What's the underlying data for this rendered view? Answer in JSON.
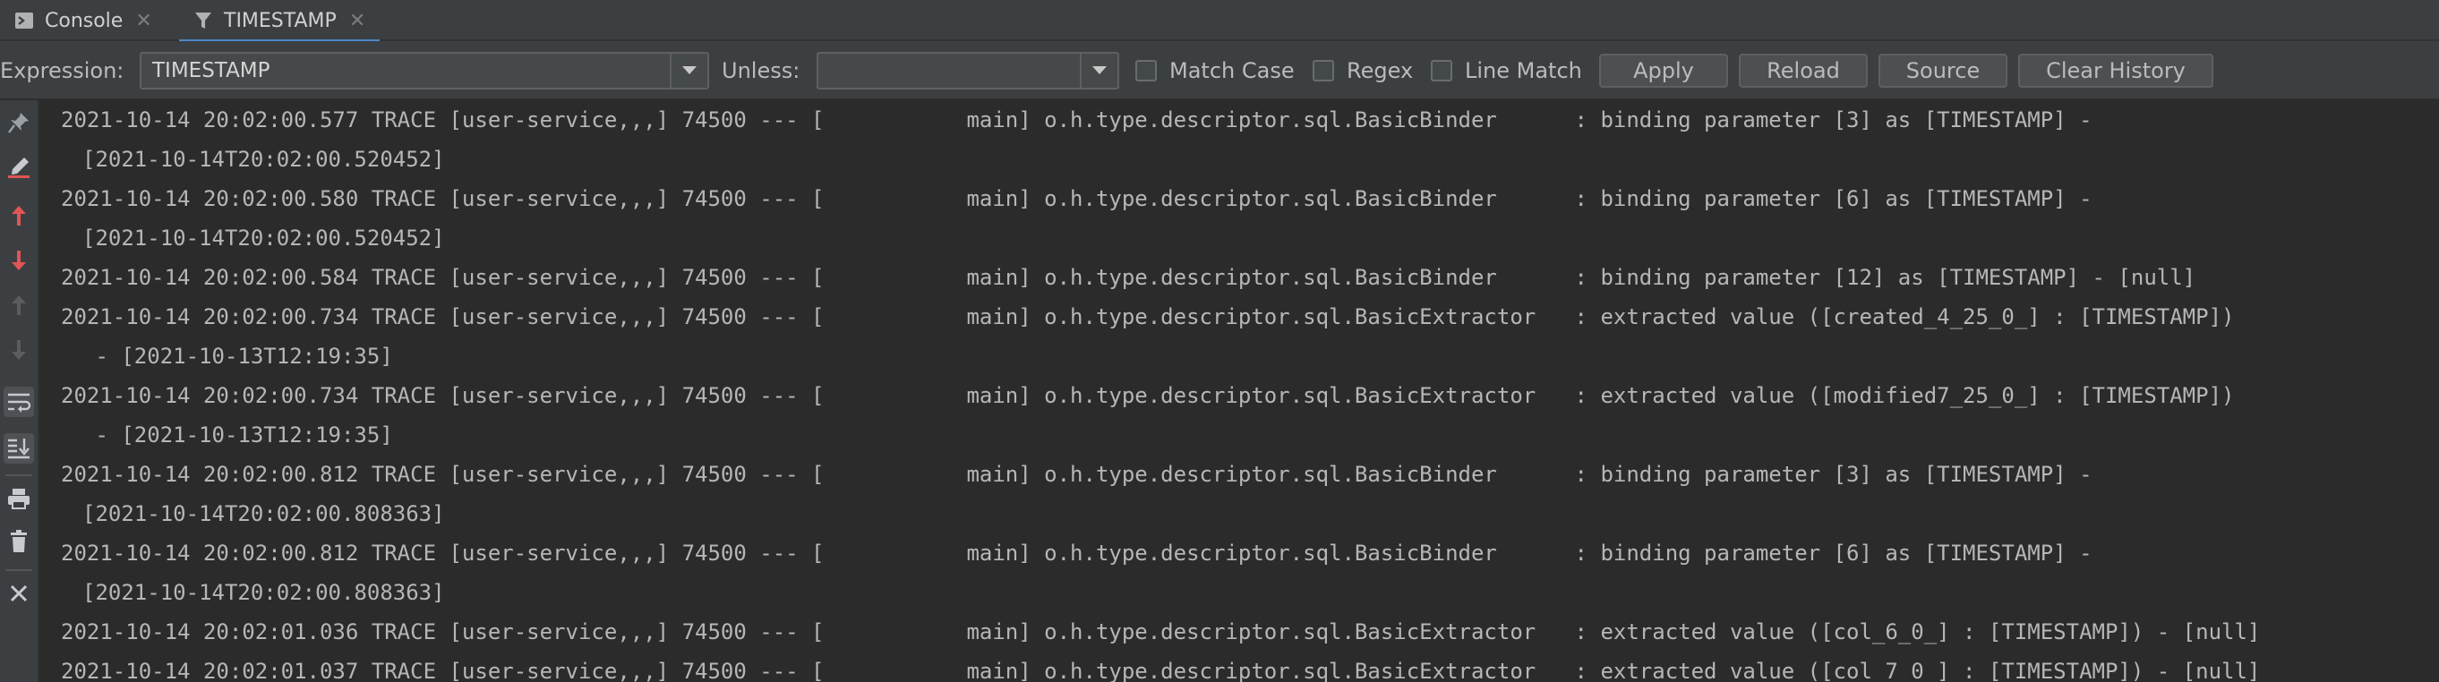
{
  "tabs": [
    {
      "label": "Console",
      "icon": "console-icon",
      "active": false
    },
    {
      "label": "TIMESTAMP",
      "icon": "filter-icon",
      "active": true
    }
  ],
  "filter": {
    "expression_label": "Expression:",
    "expression_value": "TIMESTAMP",
    "unless_label": "Unless:",
    "unless_value": "",
    "match_case_label": "Match Case",
    "regex_label": "Regex",
    "line_match_label": "Line Match",
    "apply_label": "Apply",
    "reload_label": "Reload",
    "source_label": "Source",
    "clear_history_label": "Clear History"
  },
  "gutter_icons": [
    "pin-icon",
    "clear-highlight-icon",
    "up-arrow-icon",
    "down-arrow-icon",
    "up-arrow-disabled-icon",
    "down-arrow-disabled-icon",
    "soft-wrap-icon",
    "scroll-to-end-icon",
    "print-icon",
    "trash-icon",
    "close-icon"
  ],
  "colors": {
    "accent": "#4a88c7",
    "up_arrow": "#e05555",
    "down_arrow": "#e05555"
  },
  "log_lines": [
    "2021-10-14 20:02:00.577 TRACE [user-service,,,] 74500 --- [           main] o.h.type.descriptor.sql.BasicBinder      : binding parameter [3] as [TIMESTAMP] -",
    "[2021-10-14T20:02:00.520452]",
    "2021-10-14 20:02:00.580 TRACE [user-service,,,] 74500 --- [           main] o.h.type.descriptor.sql.BasicBinder      : binding parameter [6] as [TIMESTAMP] -",
    "[2021-10-14T20:02:00.520452]",
    "2021-10-14 20:02:00.584 TRACE [user-service,,,] 74500 --- [           main] o.h.type.descriptor.sql.BasicBinder      : binding parameter [12] as [TIMESTAMP] - [null]",
    "2021-10-14 20:02:00.734 TRACE [user-service,,,] 74500 --- [           main] o.h.type.descriptor.sql.BasicExtractor   : extracted value ([created_4_25_0_] : [TIMESTAMP])",
    " - [2021-10-13T12:19:35]",
    "2021-10-14 20:02:00.734 TRACE [user-service,,,] 74500 --- [           main] o.h.type.descriptor.sql.BasicExtractor   : extracted value ([modified7_25_0_] : [TIMESTAMP])",
    " - [2021-10-13T12:19:35]",
    "2021-10-14 20:02:00.812 TRACE [user-service,,,] 74500 --- [           main] o.h.type.descriptor.sql.BasicBinder      : binding parameter [3] as [TIMESTAMP] -",
    "[2021-10-14T20:02:00.808363]",
    "2021-10-14 20:02:00.812 TRACE [user-service,,,] 74500 --- [           main] o.h.type.descriptor.sql.BasicBinder      : binding parameter [6] as [TIMESTAMP] -",
    "[2021-10-14T20:02:00.808363]",
    "2021-10-14 20:02:01.036 TRACE [user-service,,,] 74500 --- [           main] o.h.type.descriptor.sql.BasicExtractor   : extracted value ([col_6_0_] : [TIMESTAMP]) - [null]",
    "2021-10-14 20:02:01.037 TRACE [user-service,,,] 74500 --- [           main] o.h.type.descriptor.sql.BasicExtractor   : extracted value ([col_7_0_] : [TIMESTAMP]) - [null]"
  ]
}
